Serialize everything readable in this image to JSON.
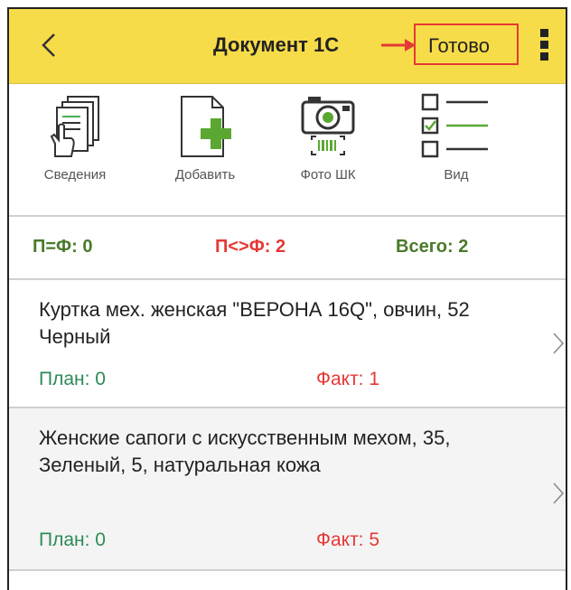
{
  "appbar": {
    "title": "Документ 1С",
    "done_label": "Готово",
    "background": "#f7dc4a",
    "highlight_color": "#e53935"
  },
  "toolbar": {
    "tools": [
      {
        "label": "Сведения",
        "icon": "document-hand-icon"
      },
      {
        "label": "Добавить",
        "icon": "add-document-icon"
      },
      {
        "label": "Фото ШК",
        "icon": "camera-barcode-icon"
      },
      {
        "label": "Вид",
        "icon": "checklist-icon"
      }
    ]
  },
  "stats": {
    "match": "П=Ф: 0",
    "mismatch": "П<>Ф: 2",
    "total": "Всего: 2",
    "colors": {
      "match": "#4a7a2a",
      "mismatch": "#e53935",
      "total": "#4a7a2a"
    }
  },
  "items": [
    {
      "name": "Куртка мех. женская \"ВЕРОНА 16Q\", овчин, 52 Черный",
      "plan": "План: 0",
      "fact": "Факт: 1"
    },
    {
      "name": "Женские сапоги с искусственным мехом, 35, Зеленый, 5, натуральная кожа",
      "plan": "План: 0",
      "fact": "Факт: 5"
    }
  ]
}
